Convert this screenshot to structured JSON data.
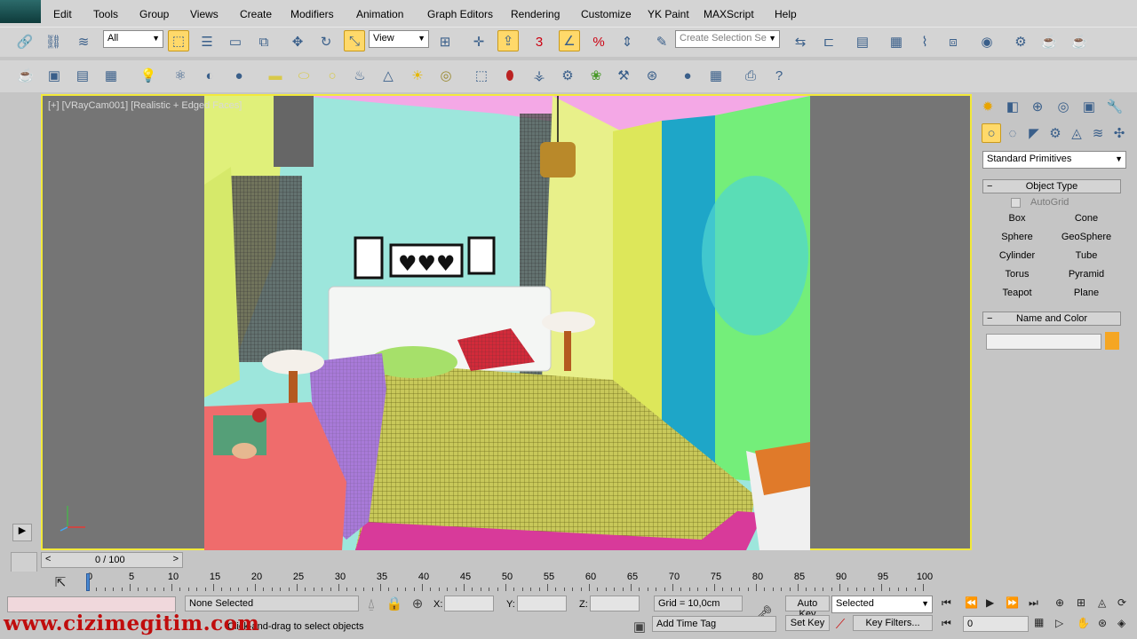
{
  "menu": [
    "Edit",
    "Tools",
    "Group",
    "Views",
    "Create",
    "Modifiers",
    "Animation",
    "Graph Editors",
    "Rendering",
    "Customize",
    "YK Paint",
    "MAXScript",
    "Help"
  ],
  "toolbar": {
    "selection_filter": "All",
    "ref_coord": "View",
    "snap_label": "3",
    "named_selection_placeholder": "Create Selection Se"
  },
  "viewport": {
    "label": "[+] [VRayCam001] [Realistic + Edged Faces]",
    "highlight_color": "#f2e93a"
  },
  "command_panel": {
    "category": "Standard Primitives",
    "object_type_title": "Object Type",
    "autogrid": "AutoGrid",
    "buttons": [
      "Box",
      "Cone",
      "Sphere",
      "GeoSphere",
      "Cylinder",
      "Tube",
      "Torus",
      "Pyramid",
      "Teapot",
      "Plane"
    ],
    "name_color_title": "Name and Color",
    "object_color": "#f5a623"
  },
  "time": {
    "frame_counter": "0 / 100",
    "ticks": [
      "0",
      "5",
      "10",
      "15",
      "20",
      "25",
      "30",
      "35",
      "40",
      "45",
      "50",
      "55",
      "60",
      "65",
      "70",
      "75",
      "80",
      "85",
      "90",
      "95",
      "100"
    ]
  },
  "status": {
    "selection": "None Selected",
    "prompt": "Click-and-drag to select objects",
    "x_label": "X:",
    "y_label": "Y:",
    "z_label": "Z:",
    "grid": "Grid = 10,0cm",
    "add_time_tag": "Add Time Tag",
    "auto_key": "Auto Key",
    "set_key": "Set Key",
    "key_mode": "Selected",
    "key_filters": "Key Filters...",
    "current_frame": "0"
  },
  "watermark": "www.cizimegitim.com"
}
